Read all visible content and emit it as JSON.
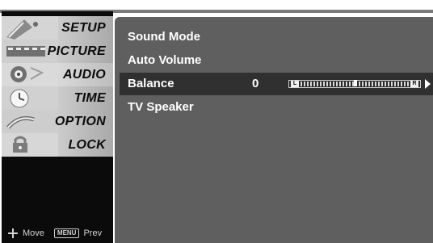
{
  "sidebar": {
    "items": [
      {
        "label": "SETUP",
        "icon": "satellite-icon"
      },
      {
        "label": "PICTURE",
        "icon": "film-strip-icon"
      },
      {
        "label": "AUDIO",
        "icon": "speaker-icon"
      },
      {
        "label": "TIME",
        "icon": "clock-icon"
      },
      {
        "label": "OPTION",
        "icon": "option-icon"
      },
      {
        "label": "LOCK",
        "icon": "lock-icon"
      }
    ],
    "active_index": 2
  },
  "footer_hint": {
    "move_label": "Move",
    "menu_key_label": "MENU",
    "prev_label": "Prev"
  },
  "audio_menu": {
    "rows": [
      {
        "label": "Sound Mode"
      },
      {
        "label": "Auto Volume"
      },
      {
        "label": "Balance",
        "value": "0",
        "selected": true
      },
      {
        "label": "TV Speaker"
      }
    ],
    "balance": {
      "left_label": "L",
      "right_label": "R",
      "value": 0,
      "min": -50,
      "max": 50
    }
  },
  "colors": {
    "panel": "#5f5f5f",
    "selected_row": "#303030",
    "sidebar": "#0b0b0b"
  }
}
